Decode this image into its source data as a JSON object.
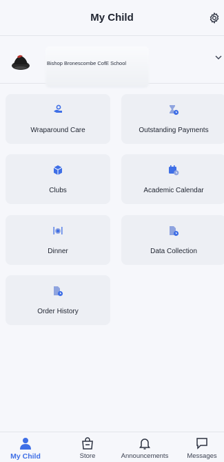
{
  "header": {
    "title": "My Child"
  },
  "child": {
    "school": "Bishop Bronescombe CofE School"
  },
  "tiles": [
    {
      "label": "Wraparound Care",
      "icon": "hand-coin-icon"
    },
    {
      "label": "Outstanding Payments",
      "icon": "hourglass-clock-icon"
    },
    {
      "label": "Clubs",
      "icon": "cube-icon"
    },
    {
      "label": "Academic Calendar",
      "icon": "calendar-clock-icon"
    },
    {
      "label": "Dinner",
      "icon": "dinner-plate-icon"
    },
    {
      "label": "Data Collection",
      "icon": "document-clock-icon"
    },
    {
      "label": "Order History",
      "icon": "document-clock-icon"
    }
  ],
  "nav": [
    {
      "label": "My Child",
      "icon": "person-icon"
    },
    {
      "label": "Store",
      "icon": "shopping-bag-icon"
    },
    {
      "label": "Announcements",
      "icon": "bell-icon"
    },
    {
      "label": "Messages",
      "icon": "chat-bubble-icon"
    }
  ],
  "colors": {
    "accent": "#3f6fe6",
    "tile_bg": "#edeff4",
    "page_bg": "#f6f7fb"
  }
}
